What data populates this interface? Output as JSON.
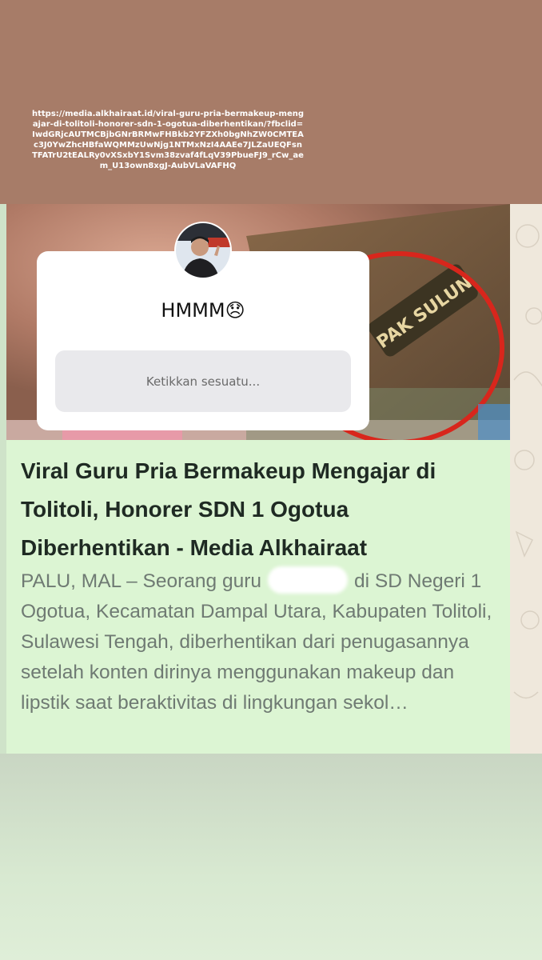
{
  "story": {
    "link_url": "https://media.alkhairaat.id/viral-guru-pria-bermakeup-mengajar-di-tolitoli-honorer-sdn-1-ogotua-diberhentikan/?fbclid=IwdGRjcAUTMCBjbGNrBRMwFHBkb2YFZXh0bgNhZW0CMTEAc3J0YwZhcHBfaWQMMzUwNjg1NTMxNzI4AAEe7JLZaUEQFsnTFATrU2tEALRy0vXSxbY1Svm38zvaf4fLqV39PbueFJ9_rCw_aem_U13own8xgJ-AubVLaVAFHQ"
  },
  "question_sticker": {
    "title": "HMMM😞",
    "input_placeholder": "Ketikkan sesuatu..."
  },
  "link_preview": {
    "headline": "Viral Guru Pria Bermakeup Mengajar di Tolitoli, Honorer SDN 1 Ogotua Diberhentikan - Media Alkhairaat",
    "description_before_redaction": "PALU, MAL – Seorang guru",
    "description_after_redaction": "di SD Negeri 1 Ogotua, Kecamatan Dampal Utara, Kabupaten Tolitoli, Sulawesi Tengah, diberhentikan dari penugasannya setelah konten dirinya menggunakan makeup dan lipstik saat beraktivitas di lingkungan sekol…"
  },
  "thumbnail": {
    "badge_text": "PAK SULUN"
  },
  "colors": {
    "top_band": "#a77c68",
    "card_background": "#dcf5d3",
    "highlight_circle": "#d8261c"
  }
}
